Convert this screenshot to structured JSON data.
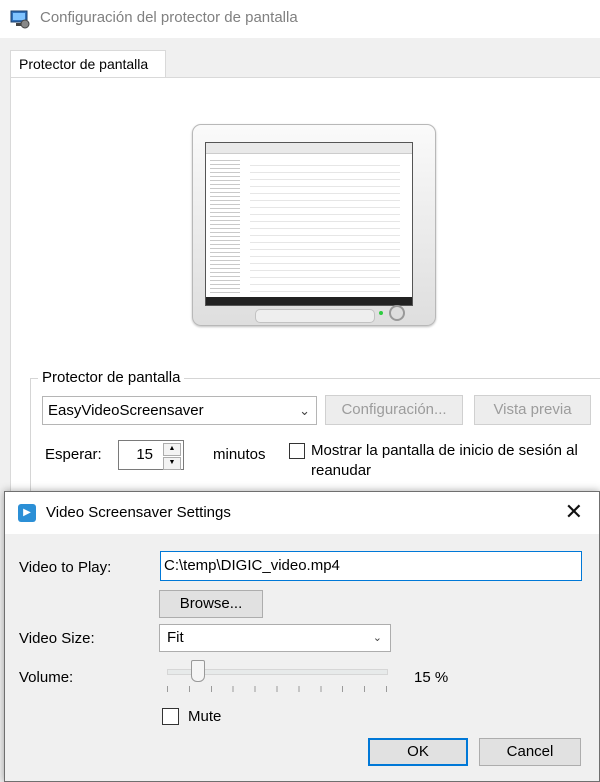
{
  "background_window": {
    "title": "Configuración del protector de pantalla",
    "tab": "Protector de pantalla",
    "group_label": "Protector de pantalla",
    "screensaver_selected": "EasyVideoScreensaver",
    "settings_button": "Configuración...",
    "preview_button": "Vista previa",
    "wait_label": "Esperar:",
    "wait_value": "15",
    "minutes_label": "minutos",
    "resume_checkbox_label": "Mostrar la pantalla de inicio de sesión al reanudar"
  },
  "dialog": {
    "title": "Video Screensaver Settings",
    "video_label": "Video to Play:",
    "video_path": "C:\\temp\\DIGIC_video.mp4",
    "browse_button": "Browse...",
    "size_label": "Video Size:",
    "size_value": "Fit",
    "volume_label": "Volume:",
    "volume_percent": 15,
    "volume_text": "15 %",
    "mute_label": "Mute",
    "mute_checked": false,
    "ok_button": "OK",
    "cancel_button": "Cancel"
  },
  "colors": {
    "accent": "#0078d7",
    "disabled_text": "#9c9c9c"
  },
  "icons": {
    "app": "display-settings-icon",
    "dialog": "play-icon",
    "close": "close-icon",
    "dropdown": "chevron-down-icon"
  }
}
